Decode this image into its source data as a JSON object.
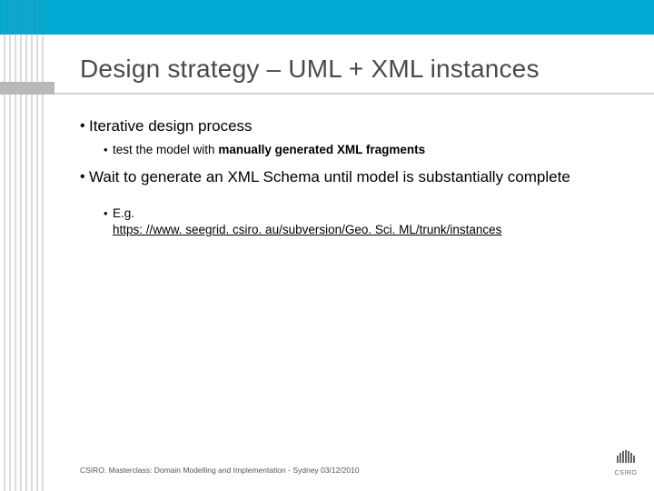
{
  "title": "Design strategy – UML + XML instances",
  "bullets": {
    "item1": {
      "text": "Iterative design process",
      "sub": {
        "prefix": "test the model with ",
        "bold": "manually generated XML fragments"
      }
    },
    "item2": {
      "text": "Wait to generate an XML Schema until model is substantially complete",
      "sub": {
        "eg": "E.g.",
        "link": "https: //www. seegrid. csiro. au/subversion/Geo. Sci. ML/trunk/instances"
      }
    }
  },
  "footer": "CSIRO.  Masterclass: Domain Modelling and Implementation  -  Sydney 03/12/2010",
  "logo_label": "CSIRO"
}
